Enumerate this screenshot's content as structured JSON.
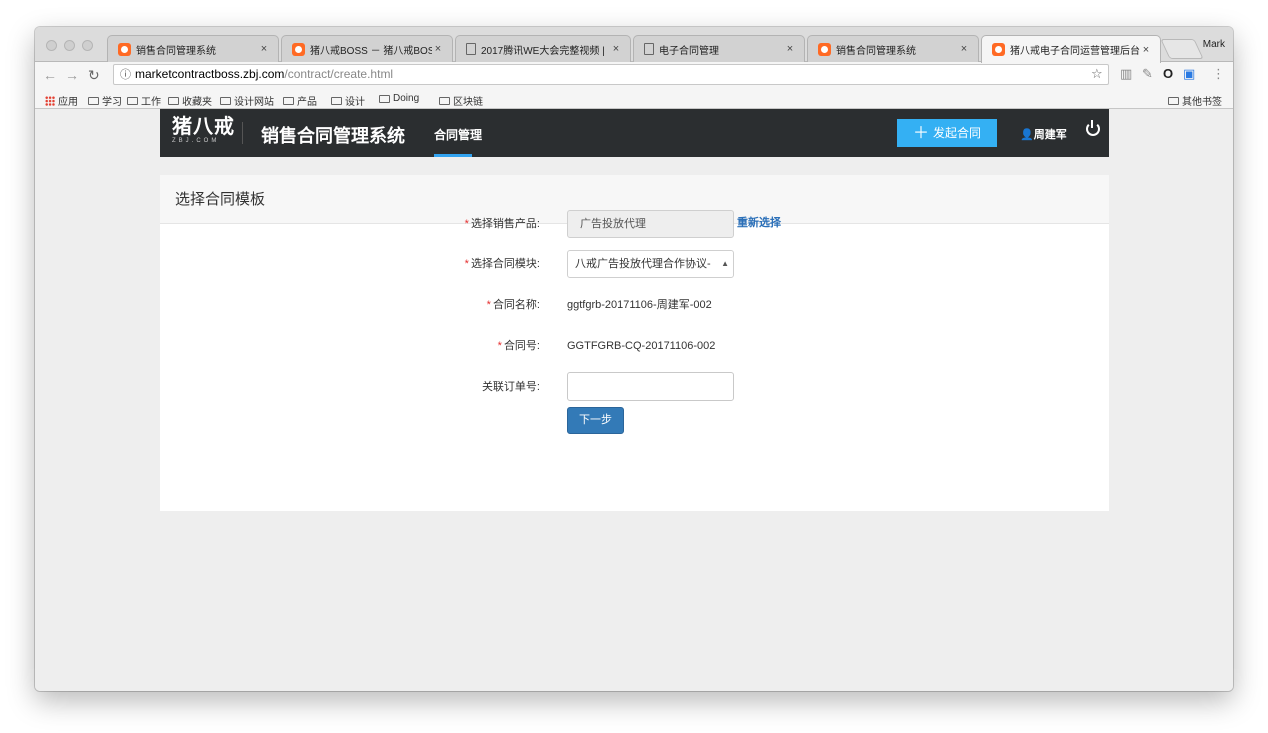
{
  "browser": {
    "tabs": [
      {
        "title": "销售合同管理系统",
        "icon": "zbj-favicon-icon"
      },
      {
        "title": "猪八戒BOSS － 猪八戒BOSS",
        "icon": "zbj-favicon-icon"
      },
      {
        "title": "2017腾讯WE大会完整视频 | ",
        "icon": "document-icon"
      },
      {
        "title": "电子合同管理",
        "icon": "document-icon"
      },
      {
        "title": "销售合同管理系统",
        "icon": "zbj-favicon-icon"
      },
      {
        "title": "猪八戒电子合同运营管理后台",
        "icon": "zbj-favicon-icon"
      }
    ],
    "profile_name": "Mark",
    "url_host": "marketcontractboss.zbj.com",
    "url_path": "/contract/create.html",
    "bookmarks": [
      {
        "label": "应用"
      },
      {
        "label": "学习"
      },
      {
        "label": "工作"
      },
      {
        "label": "收藏夹"
      },
      {
        "label": "设计网站"
      },
      {
        "label": "产品"
      },
      {
        "label": "设计"
      },
      {
        "label": "Doing"
      },
      {
        "label": "区块链"
      }
    ],
    "other_bookmarks": "其他书签"
  },
  "header": {
    "logo_main": "猪八戒",
    "logo_sub": "ZBJ.COM",
    "system_title": "销售合同管理系统",
    "nav_item": "合同管理",
    "create_button": "发起合同",
    "user_name": "周建军"
  },
  "panel": {
    "title": "选择合同模板",
    "fields": {
      "product_label": "选择销售产品:",
      "product_value": "广告投放代理",
      "reselect_link": "重新选择",
      "module_label": "选择合同模块:",
      "module_value": "八戒广告投放代理合作协议-",
      "name_label": "合同名称:",
      "name_value": "ggtfgrb-20171106-周建军-002",
      "number_label": "合同号:",
      "number_value": "GGTFGRB-CQ-20171106-002",
      "order_label": "关联订单号:",
      "order_value": "",
      "required_mark": "*"
    },
    "next_button": "下一步"
  },
  "colors": {
    "header_bg": "#2b2e30",
    "accent_blue": "#34b0f3",
    "primary_button": "#337ab7",
    "link": "#2a6fb8",
    "required": "#e52e2e"
  }
}
